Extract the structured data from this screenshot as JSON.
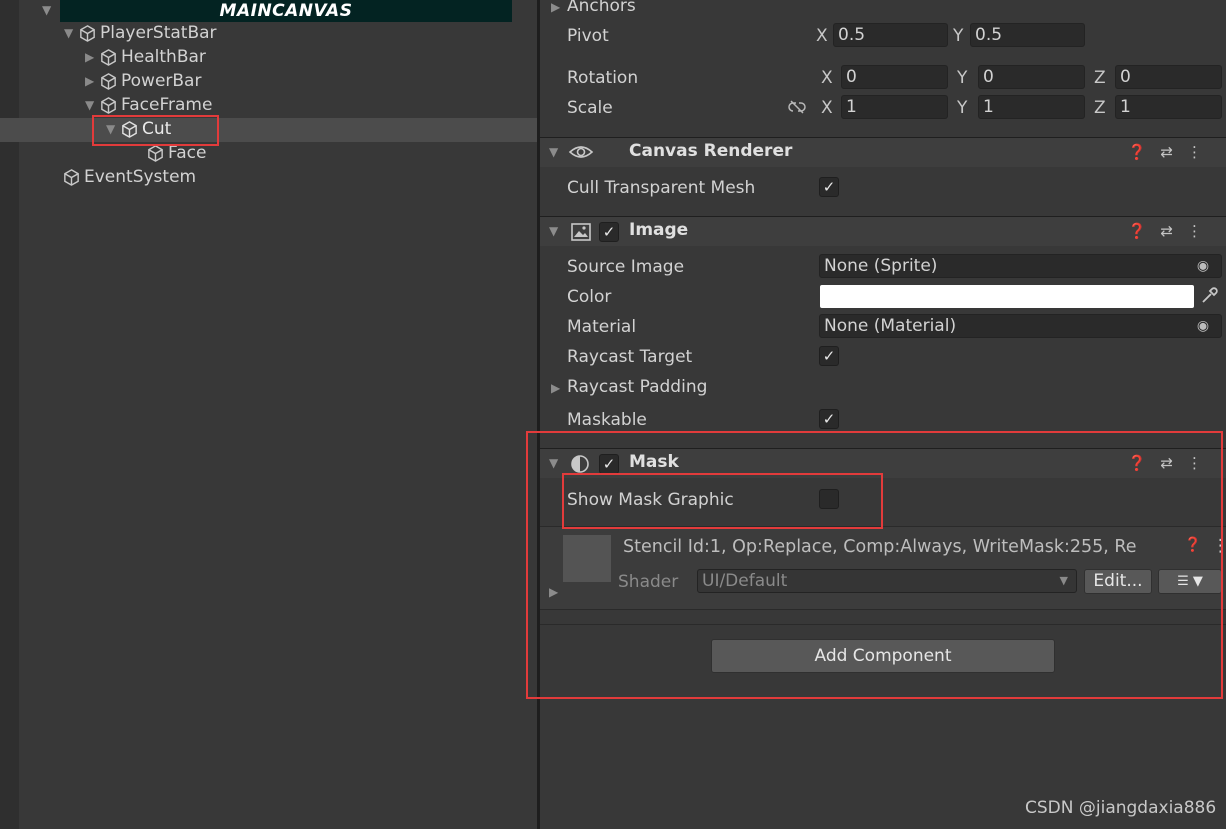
{
  "hierarchy": {
    "canvas_title": "MAINCANVAS",
    "items": [
      {
        "label": "PlayerStatBar"
      },
      {
        "label": "HealthBar"
      },
      {
        "label": "PowerBar"
      },
      {
        "label": "FaceFrame"
      },
      {
        "label": "Cut"
      },
      {
        "label": "Face"
      },
      {
        "label": "EventSystem"
      }
    ]
  },
  "rect_transform": {
    "anchors_label": "Anchors",
    "pivot_label": "Pivot",
    "pivot_x": "0.5",
    "pivot_y": "0.5",
    "rotation_label": "Rotation",
    "rotation": [
      "0",
      "0",
      "0"
    ],
    "scale_label": "Scale",
    "scale": [
      "1",
      "1",
      "1"
    ],
    "axis_x": "X",
    "axis_y": "Y",
    "axis_z": "Z"
  },
  "canvas_renderer": {
    "title": "Canvas Renderer",
    "cull_label": "Cull Transparent Mesh",
    "cull_checked": true
  },
  "image": {
    "title": "Image",
    "source_image_label": "Source Image",
    "source_image_value": "None (Sprite)",
    "color_label": "Color",
    "color_value": "#ffffff",
    "material_label": "Material",
    "material_value": "None (Material)",
    "raycast_target_label": "Raycast Target",
    "raycast_padding_label": "Raycast Padding",
    "maskable_label": "Maskable"
  },
  "mask": {
    "title": "Mask",
    "show_mask_graphic_label": "Show Mask Graphic",
    "show_mask_graphic_checked": false
  },
  "material_preview": {
    "stencil_text": "Stencil Id:1, Op:Replace, Comp:Always, WriteMask:255, Re",
    "shader_label": "Shader",
    "shader_value": "UI/Default",
    "edit_label": "Edit..."
  },
  "add_component_label": "Add Component",
  "watermark": "CSDN @jiangdaxia886",
  "colors": {
    "highlight_red": "#e23b3b",
    "panel_bg": "#383838",
    "canvas_bar": "#032322"
  }
}
